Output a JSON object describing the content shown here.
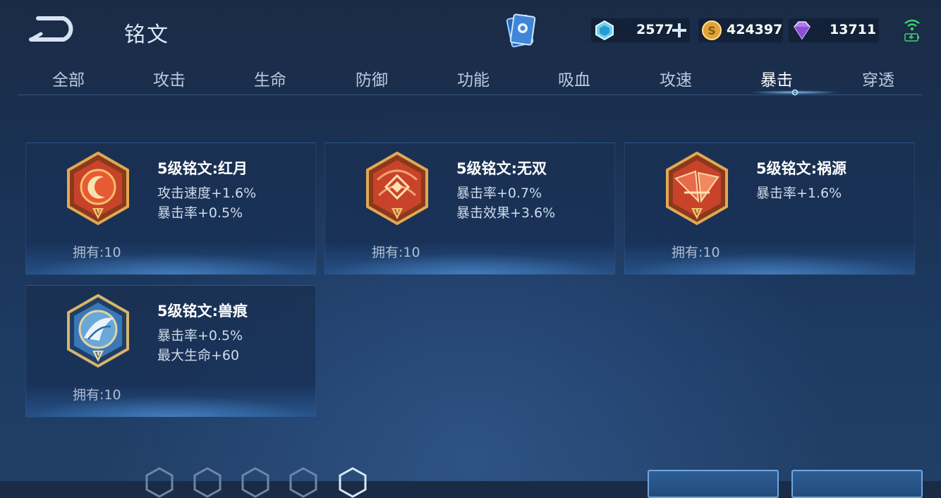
{
  "header": {
    "title": "铭文"
  },
  "currencies": {
    "crystal": {
      "value": "2577",
      "icon": "blue-crystal-icon"
    },
    "gold": {
      "value": "424397",
      "icon": "gold-coin-icon"
    },
    "gem": {
      "value": "13711",
      "icon": "purple-gem-icon"
    }
  },
  "tabs": [
    {
      "label": "全部"
    },
    {
      "label": "攻击"
    },
    {
      "label": "生命"
    },
    {
      "label": "防御"
    },
    {
      "label": "功能"
    },
    {
      "label": "吸血"
    },
    {
      "label": "攻速"
    },
    {
      "label": "暴击"
    },
    {
      "label": "穿透"
    }
  ],
  "active_tab": "暴击",
  "runes": [
    {
      "name": "5级铭文:红月",
      "attrs": [
        "攻击速度+1.6%",
        "暴击率+0.5%"
      ],
      "owned": "拥有:10",
      "color": "red",
      "icon": "red-moon-emblem-icon"
    },
    {
      "name": "5级铭文:无双",
      "attrs": [
        "暴击率+0.7%",
        "暴击效果+3.6%"
      ],
      "owned": "拥有:10",
      "color": "red",
      "icon": "unrivaled-emblem-icon"
    },
    {
      "name": "5级铭文:祸源",
      "attrs": [
        "暴击率+1.6%"
      ],
      "owned": "拥有:10",
      "color": "red",
      "icon": "calamity-emblem-icon"
    },
    {
      "name": "5级铭文:兽痕",
      "attrs": [
        "暴击率+0.5%",
        "最大生命+60"
      ],
      "owned": "拥有:10",
      "color": "blue",
      "icon": "beast-mark-emblem-icon"
    }
  ],
  "colors": {
    "red_emblem": "#c8432a",
    "blue_emblem": "#3a78b8",
    "gold_rim": "#d9a24a"
  }
}
